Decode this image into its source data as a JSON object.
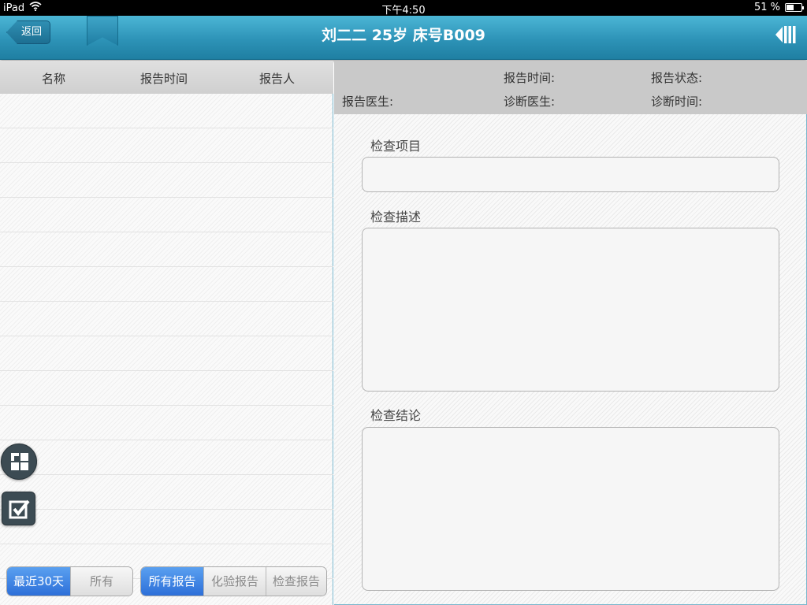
{
  "status_bar": {
    "device": "iPad",
    "time": "下午4:50",
    "battery_text": "51 %",
    "battery_level": 0.51
  },
  "navbar": {
    "back_label": "返回",
    "title": "刘二二 25岁 床号B009",
    "icons": [
      "wifi-icon",
      "bookmark-ribbon-icon",
      "collapse-panel-icon"
    ]
  },
  "left_panel": {
    "columns": [
      "名称",
      "报告时间",
      "报告人"
    ],
    "rows": [
      "",
      "",
      "",
      "",
      "",
      "",
      "",
      "",
      "",
      "",
      "",
      "",
      "",
      ""
    ],
    "time_filter": {
      "options": [
        "最近30天",
        "所有"
      ],
      "selected": "最近30天"
    },
    "type_filter": {
      "options": [
        "所有报告",
        "化验报告",
        "检查报告"
      ],
      "selected": "所有报告"
    }
  },
  "detail": {
    "report_time_label": "报告时间:",
    "report_status_label": "报告状态:",
    "report_doctor_label": "报告医生:",
    "diagnosis_doctor_label": "诊断医生:",
    "diagnosis_time_label": "诊断时间:",
    "exam_item_label": "检查项目",
    "exam_item_value": "",
    "exam_desc_label": "检查描述",
    "exam_desc_value": "",
    "exam_conclusion_label": "检查结论",
    "exam_conclusion_value": ""
  },
  "colors": {
    "navbar": "#2d93b7",
    "segment_active": "#3d7fe0",
    "info_bar": "#c9c9c9",
    "float_button": "#3c4b53"
  }
}
